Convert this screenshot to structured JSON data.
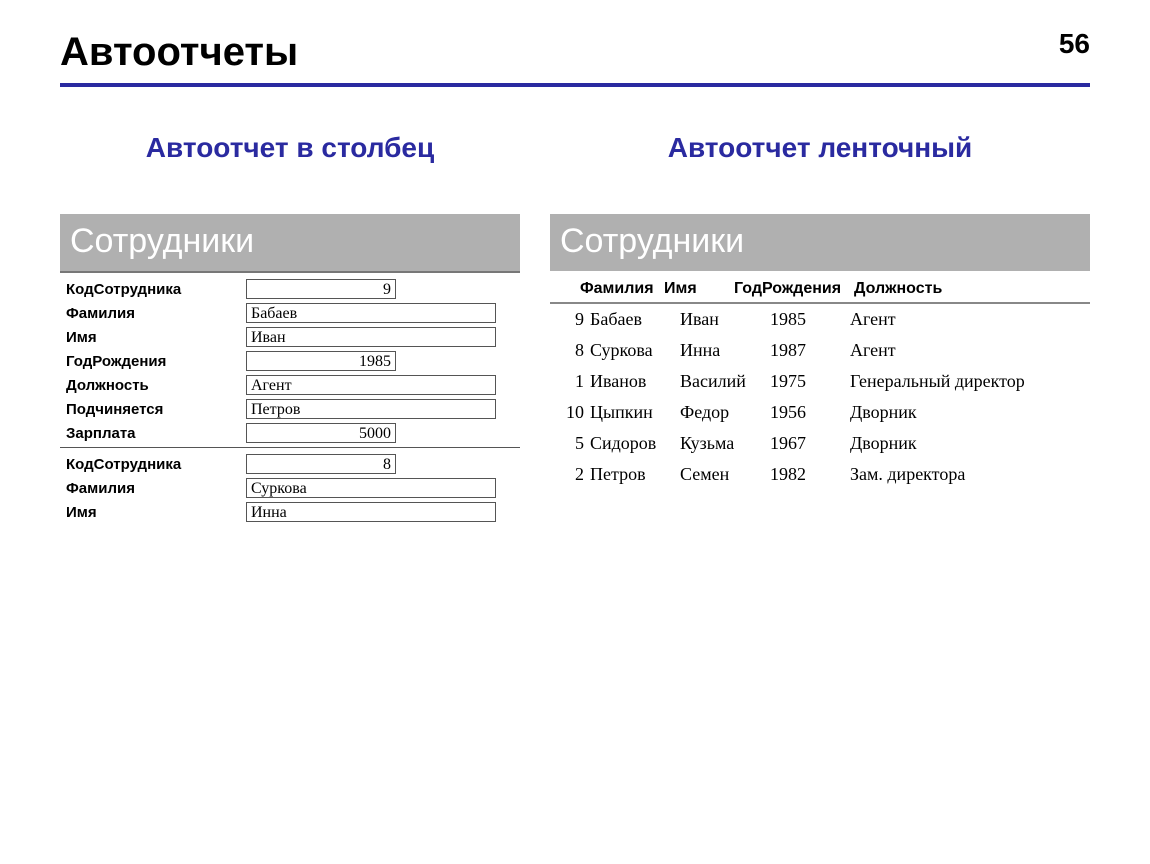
{
  "page_number": "56",
  "title": "Автоотчеты",
  "left": {
    "heading": "Автоотчет в столбец",
    "banner": "Сотрудники",
    "labels": {
      "code": "КодСотрудника",
      "surname": "Фамилия",
      "name": "Имя",
      "birth": "ГодРождения",
      "position": "Должность",
      "reports_to": "Подчиняется",
      "salary": "Зарплата"
    },
    "records": [
      {
        "code": "9",
        "surname": "Бабаев",
        "name": "Иван",
        "birth": "1985",
        "position": "Агент",
        "reports_to": "Петров",
        "salary": "5000"
      },
      {
        "code": "8",
        "surname": "Суркова",
        "name": "Инна"
      }
    ]
  },
  "right": {
    "heading": "Автоотчет ленточный",
    "banner": "Сотрудники",
    "columns": {
      "surname": "Фамилия",
      "name": "Имя",
      "birth": "ГодРождения",
      "position": "Должность"
    },
    "rows": [
      {
        "id": "9",
        "surname": "Бабаев",
        "name": "Иван",
        "birth": "1985",
        "position": "Агент"
      },
      {
        "id": "8",
        "surname": "Суркова",
        "name": "Инна",
        "birth": "1987",
        "position": "Агент"
      },
      {
        "id": "1",
        "surname": "Иванов",
        "name": "Василий",
        "birth": "1975",
        "position": "Генеральный директор"
      },
      {
        "id": "10",
        "surname": "Цыпкин",
        "name": "Федор",
        "birth": "1956",
        "position": "Дворник"
      },
      {
        "id": "5",
        "surname": "Сидоров",
        "name": "Кузьма",
        "birth": "1967",
        "position": "Дворник"
      },
      {
        "id": "2",
        "surname": "Петров",
        "name": "Семен",
        "birth": "1982",
        "position": "Зам. директора"
      }
    ]
  }
}
